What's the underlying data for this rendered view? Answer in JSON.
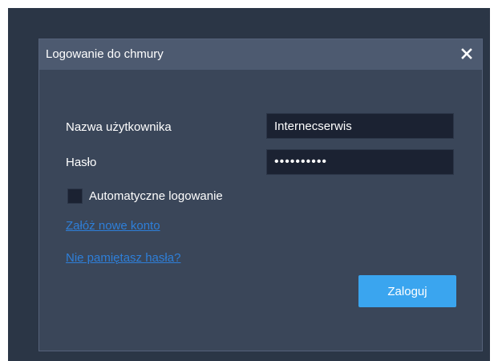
{
  "dialog": {
    "title": "Logowanie do chmury",
    "close_icon": "close-icon"
  },
  "form": {
    "username_label": "Nazwa użytkownika",
    "username_value": "Internecserwis",
    "password_label": "Hasło",
    "password_value": "••••••••••",
    "auto_login_label": "Automatyczne logowanie",
    "auto_login_checked": false,
    "create_account_link": "Załóż nowe konto",
    "forgot_password_link": "Nie pamiętasz hasła?",
    "login_button": "Zaloguj"
  },
  "colors": {
    "backdrop": "#2b3646",
    "dialog_bg": "#3a4659",
    "titlebar_bg": "#4d5a70",
    "input_bg": "#1b2232",
    "link": "#2e7fd9",
    "accent_button": "#3aa5ef"
  }
}
